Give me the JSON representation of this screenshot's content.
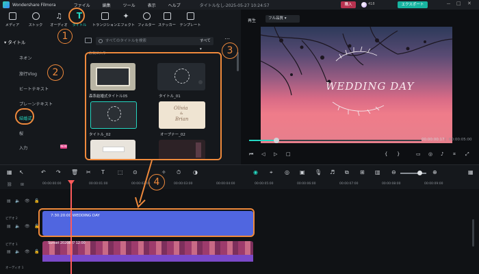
{
  "app": {
    "name": "Wondershare Filmora",
    "menu": [
      "ファイル",
      "編集",
      "ツール",
      "表示",
      "ヘルプ"
    ],
    "project_title": "タイトルなし-2025-05-27 10:24:57",
    "buy_label": "購入",
    "credits": "418",
    "export_label": "エクスポート",
    "window_controls": [
      "－",
      "□",
      "✕"
    ]
  },
  "categories": [
    {
      "label": "メディア",
      "icon": "folder-icon"
    },
    {
      "label": "ストック",
      "icon": "cloud-icon"
    },
    {
      "label": "オーディオ",
      "icon": "music-note-icon"
    },
    {
      "label": "タイトル",
      "icon": "title-t-icon",
      "active": true
    },
    {
      "label": "トランジション",
      "icon": "transition-icon"
    },
    {
      "label": "エフェクト",
      "icon": "effects-icon"
    },
    {
      "label": "フィルター",
      "icon": "filter-icon"
    },
    {
      "label": "ステッカー",
      "icon": "sticker-icon"
    },
    {
      "label": "テンプレート",
      "icon": "template-icon"
    }
  ],
  "sidebar": {
    "header": "タイトル",
    "items": [
      {
        "label": "ネオン"
      },
      {
        "label": "旅行Vlog"
      },
      {
        "label": "ビートテキスト"
      },
      {
        "label": "プレーンテキスト"
      },
      {
        "label": "結婚式",
        "active": true
      },
      {
        "label": "桜"
      },
      {
        "label": "入力",
        "badge": "NEW"
      }
    ]
  },
  "library": {
    "search_placeholder": "すべてのタイトルを検索",
    "filter_value": "すべて",
    "more_label": "⋯",
    "section_label": "お気に入り",
    "items": [
      {
        "label": "森系結婚式タイトル05"
      },
      {
        "label": "タイトル_01"
      },
      {
        "label": "タイトル_02"
      },
      {
        "label": "オープナー_02"
      }
    ],
    "thumb_texts": [
      "Olivia",
      "&",
      "Brian"
    ]
  },
  "preview": {
    "label": "再生",
    "quality": "フル品質",
    "video_caption": "WEDDING DAY",
    "current_time": "00:00:00:17",
    "total_time": "00:00:05:00",
    "progress": 0.16
  },
  "timeline": {
    "ruler_ticks": [
      "00:00:00:00",
      "00:00:01:00",
      "00:00:02:00",
      "00:00:03:00",
      "00:00:04:00",
      "00:00:05:00",
      "00:00:06:00",
      "00:00:07:00",
      "00:00:08:00",
      "00:00:09:00"
    ],
    "title_clip": "7:30:20:00 WEDDING DAY",
    "video_clip": "Sunset 2020807 12:00",
    "track_labels": [
      "ビデオ 2",
      "ビデオ 1",
      "オーディオ 1"
    ]
  },
  "annotations": [
    "1",
    "2",
    "3",
    "4"
  ],
  "colors": {
    "accent": "#25d8c2",
    "annotation": "#f08a3c",
    "clip_title": "#5066e0",
    "playhead": "#ff5b5b"
  }
}
